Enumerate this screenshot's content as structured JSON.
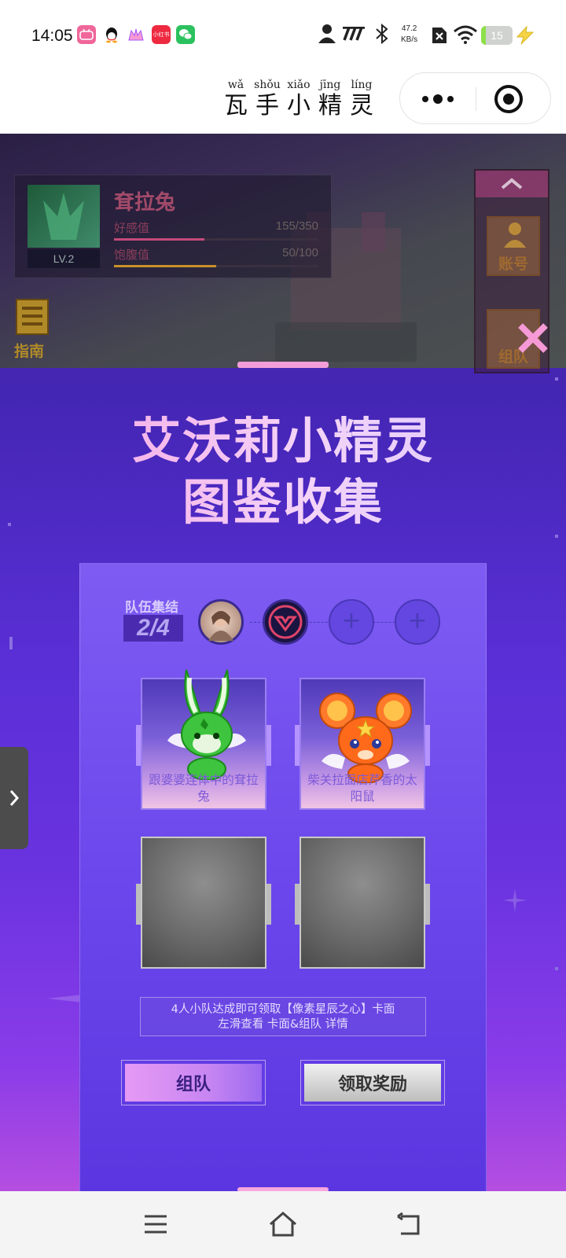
{
  "status_bar": {
    "time": "14:05",
    "net_speed_value": "47.2",
    "net_speed_unit": "KB/s",
    "battery_level": "15",
    "battery_fraction": 0.15,
    "app_icons": [
      {
        "name": "bilibili-app-icon",
        "color": "#f0679a",
        "text": "bilibili"
      },
      {
        "name": "qq-app-icon",
        "color": "#ffffff",
        "text": ""
      },
      {
        "name": "game-app-icon",
        "color": "#ffffff",
        "text": ""
      },
      {
        "name": "xiaohongshu-app-icon",
        "color": "#ee2a41",
        "text": "小红书"
      },
      {
        "name": "wechat-app-icon",
        "color": "#2bc15e",
        "text": ""
      }
    ]
  },
  "title_bar": {
    "title_chars": [
      {
        "pinyin": "wǎ",
        "hanzi": "瓦"
      },
      {
        "pinyin": "shǒu",
        "hanzi": "手"
      },
      {
        "pinyin": "xiǎo",
        "hanzi": "小"
      },
      {
        "pinyin": "jīng",
        "hanzi": "精"
      },
      {
        "pinyin": "líng",
        "hanzi": "灵"
      }
    ]
  },
  "pet": {
    "name": "耷拉兔",
    "level": "LV.2",
    "favor_label": "好感值",
    "favor_value": "155/350",
    "favor_fraction": 0.443,
    "satiety_label": "饱腹值",
    "satiety_value": "50/100",
    "satiety_fraction": 0.5
  },
  "guide_label": "指南",
  "side_menu": {
    "account_label": "账号",
    "team_label": "组队"
  },
  "panel": {
    "title_line1": "艾沃莉小精灵",
    "title_line2": "图鉴收集",
    "team_label": "队伍集结",
    "team_count": "2/4",
    "empty_slot_symbol": "+",
    "cards": [
      {
        "text": "跟婆婆连体中的耷拉兔"
      },
      {
        "text": "柴关拉面店芹香的太阳鼠"
      }
    ],
    "info_line1": "4人小队达成即可领取【像素星辰之心】卡面",
    "info_line2": "左滑查看 卡面&组队 详情",
    "team_button": "组队",
    "claim_button": "领取奖励"
  },
  "colors": {
    "accent_pink": "#f59ad6",
    "panel_purple": "#6a33e0",
    "favor_bar": "#c44a7a",
    "satiety_bar": "#c8902a"
  }
}
